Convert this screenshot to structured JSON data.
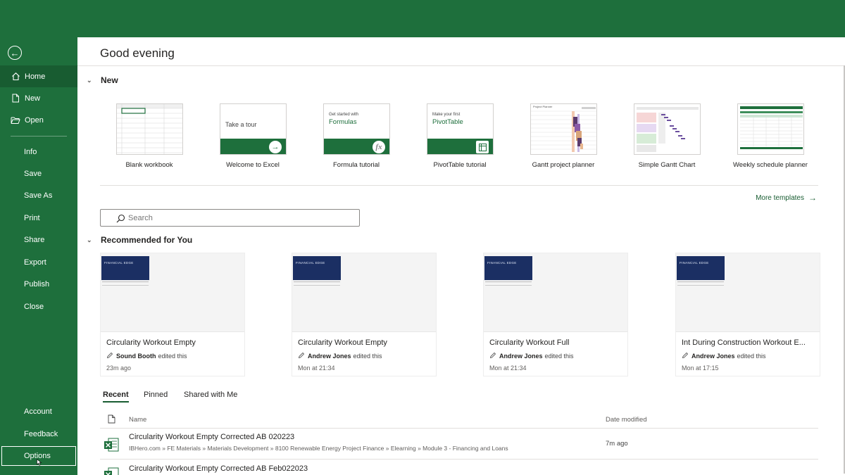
{
  "window": {
    "theme_color": "#1e6f3c",
    "active_color": "#185c31"
  },
  "sidebar": {
    "back_icon": "arrow-left-circle-icon",
    "items": [
      {
        "label": "Home",
        "icon": "house-icon"
      },
      {
        "label": "New",
        "icon": "new-document-icon"
      },
      {
        "label": "Open",
        "icon": "folder-open-icon"
      },
      {
        "label": "Info"
      },
      {
        "label": "Save"
      },
      {
        "label": "Save As"
      },
      {
        "label": "Print"
      },
      {
        "label": "Share"
      },
      {
        "label": "Export"
      },
      {
        "label": "Publish"
      },
      {
        "label": "Close"
      },
      {
        "label": "Account"
      },
      {
        "label": "Feedback"
      },
      {
        "label": "Options"
      }
    ]
  },
  "main": {
    "greeting": "Good evening",
    "new_section": {
      "heading": "New",
      "templates": [
        {
          "label": "Blank workbook"
        },
        {
          "label": "Welcome to Excel",
          "thumb_text": "Take a tour"
        },
        {
          "label": "Formula tutorial",
          "thumb_small": "Get started with",
          "thumb_big": "Formulas",
          "thumb_icon": "fx"
        },
        {
          "label": "PivotTable tutorial",
          "thumb_small": "Make your first",
          "thumb_big": "PivotTable"
        },
        {
          "label": "Gantt project planner",
          "thumb_title": "Project Planner"
        },
        {
          "label": "Simple Gantt Chart"
        },
        {
          "label": "Weekly schedule planner"
        }
      ],
      "more_templates": "More templates"
    },
    "search": {
      "placeholder": "Search"
    },
    "recommended": {
      "heading": "Recommended for You",
      "edited_suffix": "edited this",
      "preview_brand": "FINANCIAL EDGE",
      "cards": [
        {
          "title": "Circularity Workout Empty",
          "editor": "Sound Booth",
          "when": "23m ago"
        },
        {
          "title": "Circularity Workout Empty",
          "editor": "Andrew Jones",
          "when": "Mon at 21:34"
        },
        {
          "title": "Circularity Workout Full",
          "editor": "Andrew Jones",
          "when": "Mon at 21:34"
        },
        {
          "title": "Int During Construction Workout E...",
          "editor": "Andrew Jones",
          "when": "Mon at 17:15"
        }
      ]
    },
    "tabs": [
      "Recent",
      "Pinned",
      "Shared with Me"
    ],
    "file_list": {
      "col_name": "Name",
      "col_date": "Date modified",
      "rows": [
        {
          "name": "Circularity Workout Empty Corrected AB 020223",
          "path": "IBHero.com » FE Materials » Materials Development » 8100 Renewable Energy Project Finance » Elearning » Module 3 - Financing and Loans",
          "date": "7m ago"
        },
        {
          "name": "Circularity Workout Empty Corrected AB Feb022023",
          "path": "",
          "date": ""
        }
      ]
    }
  }
}
